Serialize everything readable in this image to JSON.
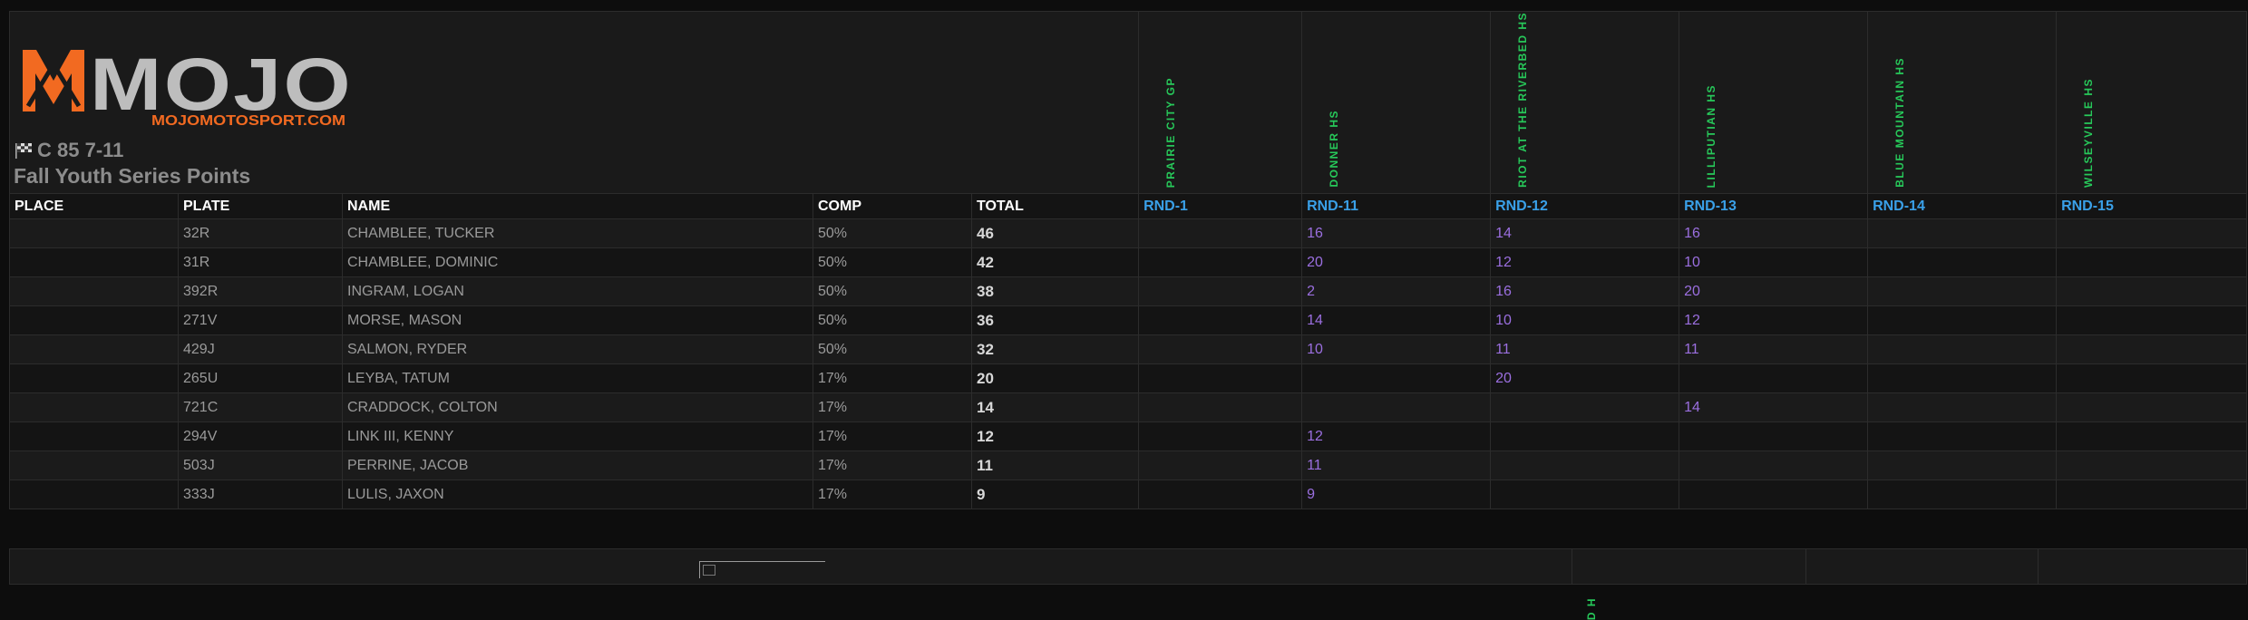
{
  "brand": {
    "name": "MOJO",
    "url": "MOJOMOTOSPORT.COM",
    "colors": {
      "accent": "#f26a21",
      "logo_gray": "#bdbdbd",
      "round_header": "#3aa0e8",
      "event_name": "#27c95a",
      "points": "#9b6fe0"
    }
  },
  "standings": {
    "class_name": "C 85 7-11",
    "series_name": "Fall Youth Series Points",
    "events": [
      "PRAIRIE CITY GP",
      "DONNER HS",
      "RIOT AT THE RIVERBED HS",
      "LILLIPUTIAN HS",
      "BLUE MOUNTAIN HS",
      "WILSEYVILLE HS"
    ],
    "columns": {
      "place": "PLACE",
      "plate": "PLATE",
      "name": "NAME",
      "comp": "COMP",
      "total": "TOTAL",
      "rounds": [
        "RND-1",
        "RND-11",
        "RND-12",
        "RND-13",
        "RND-14",
        "RND-15"
      ]
    },
    "rows": [
      {
        "place": "",
        "plate": "32R",
        "name": "CHAMBLEE, TUCKER",
        "comp": "50%",
        "total": "46",
        "rounds": [
          "",
          "16",
          "14",
          "16",
          "",
          ""
        ]
      },
      {
        "place": "",
        "plate": "31R",
        "name": "CHAMBLEE, DOMINIC",
        "comp": "50%",
        "total": "42",
        "rounds": [
          "",
          "20",
          "12",
          "10",
          "",
          ""
        ]
      },
      {
        "place": "",
        "plate": "392R",
        "name": "INGRAM, LOGAN",
        "comp": "50%",
        "total": "38",
        "rounds": [
          "",
          "2",
          "16",
          "20",
          "",
          ""
        ]
      },
      {
        "place": "",
        "plate": "271V",
        "name": "MORSE, MASON",
        "comp": "50%",
        "total": "36",
        "rounds": [
          "",
          "14",
          "10",
          "12",
          "",
          ""
        ]
      },
      {
        "place": "",
        "plate": "429J",
        "name": "SALMON, RYDER",
        "comp": "50%",
        "total": "32",
        "rounds": [
          "",
          "10",
          "11",
          "11",
          "",
          ""
        ]
      },
      {
        "place": "",
        "plate": "265U",
        "name": "LEYBA, TATUM",
        "comp": "17%",
        "total": "20",
        "rounds": [
          "",
          "",
          "20",
          "",
          "",
          ""
        ]
      },
      {
        "place": "",
        "plate": "721C",
        "name": "CRADDOCK, COLTON",
        "comp": "17%",
        "total": "14",
        "rounds": [
          "",
          "",
          "",
          "14",
          "",
          ""
        ]
      },
      {
        "place": "",
        "plate": "294V",
        "name": "LINK III, KENNY",
        "comp": "17%",
        "total": "12",
        "rounds": [
          "",
          "12",
          "",
          "",
          "",
          ""
        ]
      },
      {
        "place": "",
        "plate": "503J",
        "name": "PERRINE, JACOB",
        "comp": "17%",
        "total": "11",
        "rounds": [
          "",
          "11",
          "",
          "",
          "",
          ""
        ]
      },
      {
        "place": "",
        "plate": "333J",
        "name": "LULIS, JAXON",
        "comp": "17%",
        "total": "9",
        "rounds": [
          "",
          "9",
          "",
          "",
          "",
          ""
        ]
      }
    ]
  },
  "next_table": {
    "partial_event_label": "D H"
  }
}
